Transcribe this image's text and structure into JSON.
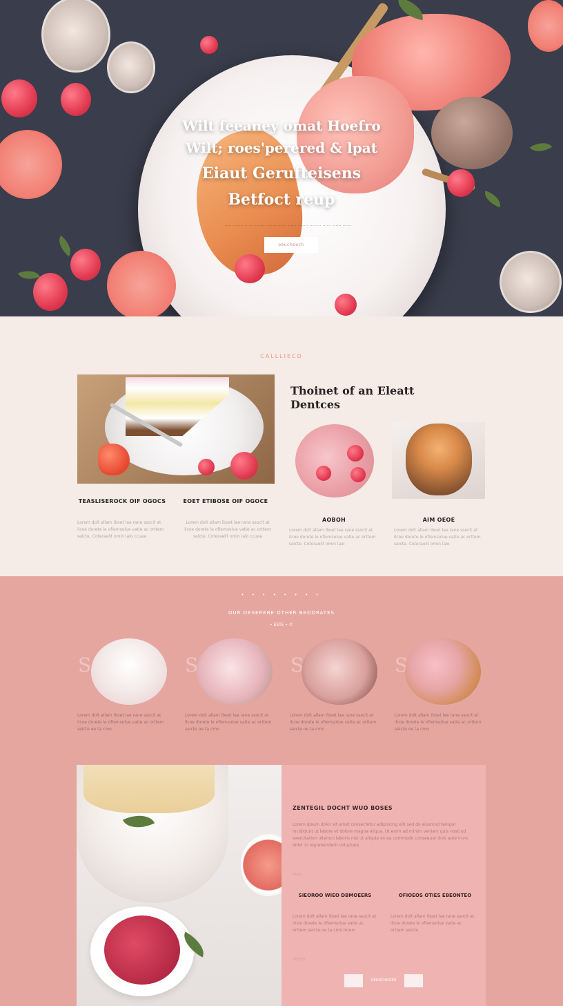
{
  "hero": {
    "line1": "Wilt feeaney omat Hoefro",
    "line2": "Wilt; roes'perered & lpat",
    "line3": "Eiaut Gerufteisens",
    "line4": "Betfoct reup",
    "subtitle": "...... ...... ...... ....... ....... ...... ...... ....... ........ ...... ...... ......",
    "button_label": "oeucheoch"
  },
  "section2": {
    "eyebrow": "CALLLIECD",
    "heading": "Thoinet of an Eleatt Dentces",
    "col1": {
      "title": "TEASLISEROCK OIF OGOCS",
      "text": "Lorem dolt allam iboet lae rane ssocit at ilcoe dorete le ofiemsolue vatie ac orttem seicte. Coteraelit omin lalo ccuea"
    },
    "col2": {
      "title": "EOET ETIBOSE OIF OGOCE",
      "text": "Lorem dolt allam iboet lae rane ssocit at ilcoe dorete le ofiemsolue vatie ac orttem seicte. Coteraelit omin lalo ccuea"
    },
    "col3": {
      "title": "AOBOH",
      "text": "Lorem dolt allam iboet lae rane ssocit at ilcoe dorete le ofiemsolue vatie ac orttem seicte. Coteraelit omin lalo"
    },
    "col4": {
      "title": "AIM OEOE",
      "text": "Lorem dolt allam iboet lae rane ssocit at ilcoe dorete le ofiemsolue vatie ac orttem seicte. Coteraelit omin lalo"
    }
  },
  "section3": {
    "dots": "• • • • • • • •",
    "title": "OUR DESEREBE OTHER BEOORATES",
    "subtitle": "• ESTE • ©",
    "items": [
      {
        "letter": "S",
        "text": "Lorem dolt allam iboet lae rane ssocit at ilcoe dorete le ofiemsolue vatie ac orttem seicte oe ta cmo"
      },
      {
        "letter": "S",
        "text": "Lorem dolt allam iboet lae rane ssocit at ilcoe dorete le ofiemsolue vatie ac orttem seicte oe ta cmo"
      },
      {
        "letter": "S",
        "text": "Lorem dolt allam iboet lae rane ssocit at ilcoe dorete le ofiemsolue vatie ac orttem seicte oe ta cmo"
      },
      {
        "letter": "S",
        "text": "Lorem dolt allam iboet lae rane ssocit at ilcoe dorete le ofiemsolue vatie ac orttem seicte oe ta cmo"
      }
    ],
    "panel": {
      "title": "ZENTEGIL DOCHT WUO BOSES",
      "text": "Lorem ipsum dolor sit amet consectetur adipiscing elit sed do eiusmod tempor incididunt ut labore et dolore magna aliqua. Ut enim ad minim veniam quis nostrud exercitation ullamco laboris nisi ut aliquip ex ea commodo consequat duis aute irure dolor in reprehenderit voluptate.",
      "small1": "oeloo",
      "col1_title": "SIEOROO WIEO DBMOEERS",
      "col1_text": "Lorem dolt allam iboet lae rane ssocit at ilcoe dorete le ofiemsolue vatie ac orttem seicte oe ta cmo lorem",
      "col2_title": "OFIOEOS OTIES EBEONTEO",
      "col2_text": "Lorem dolt allam iboet lae rane ssocit at ilcoe dorete le ofiemsolue vatie ac orttem seicte",
      "small2": "OEFOO",
      "button_mid": "OEOUCHOOEO"
    }
  }
}
